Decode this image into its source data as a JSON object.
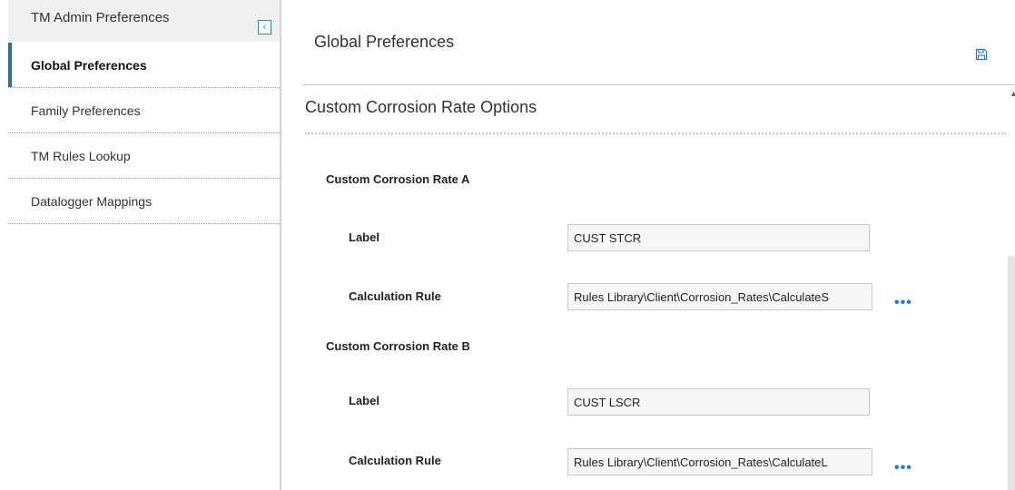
{
  "sidebar": {
    "header_title": "TM Admin Preferences",
    "collapse_icon": "chevron-left-icon",
    "items": [
      {
        "label": "Global Preferences",
        "active": true
      },
      {
        "label": "Family Preferences",
        "active": false
      },
      {
        "label": "TM Rules Lookup",
        "active": false
      },
      {
        "label": "Datalogger Mappings",
        "active": false
      }
    ]
  },
  "main": {
    "title": "Global Preferences",
    "save_icon": "save-icon",
    "section_title": "Custom Corrosion Rate Options",
    "groups": [
      {
        "title": "Custom Corrosion Rate A",
        "label_caption": "Label",
        "label_value": "CUST STCR",
        "rule_caption": "Calculation Rule",
        "rule_value": "Rules Library\\Client\\Corrosion_Rates\\CalculateS",
        "more_label": "•••"
      },
      {
        "title": "Custom Corrosion Rate B",
        "label_caption": "Label",
        "label_value": "CUST LSCR",
        "rule_caption": "Calculation Rule",
        "rule_value": "Rules Library\\Client\\Corrosion_Rates\\CalculateL",
        "more_label": "•••"
      }
    ]
  },
  "colors": {
    "accent": "#2f6f8f",
    "link_blue": "#2b7bc0",
    "sidebar_header_bg": "#f0f0f0",
    "input_bg": "#f6f6f6"
  }
}
